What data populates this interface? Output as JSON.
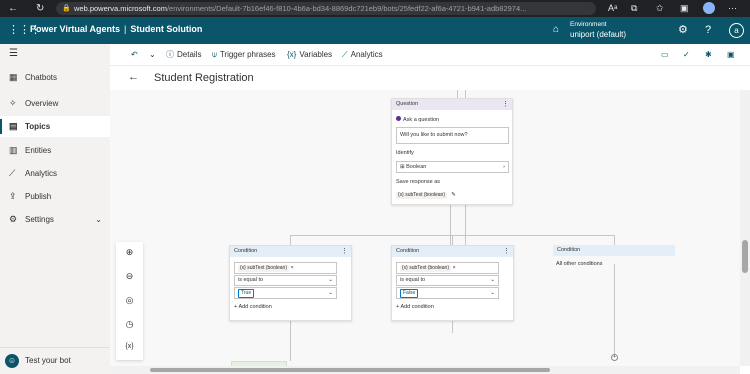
{
  "browser": {
    "url_domain": "web.powerva.microsoft.com",
    "url_path": "/environments/Default-7b16ef46-f810-4b6a-bd34-8869dc721eb9/bots/25fedf22-af6a-4721-b941-adb82974..."
  },
  "header": {
    "app_name": "Power Virtual Agents",
    "separator": "|",
    "bot_name": "Student Solution",
    "env_label": "Environment",
    "env_name": "uniport (default)",
    "avatar_initial": "a"
  },
  "sidebar": {
    "items": [
      {
        "label": "Chatbots"
      },
      {
        "label": "Overview"
      },
      {
        "label": "Topics"
      },
      {
        "label": "Entities"
      },
      {
        "label": "Analytics"
      },
      {
        "label": "Publish"
      },
      {
        "label": "Settings"
      }
    ],
    "test_bot": "Test your bot"
  },
  "toolbar": {
    "details": "Details",
    "trigger": "Trigger phrases",
    "variables": "Variables",
    "variables_icon": "{x}",
    "analytics": "Analytics"
  },
  "page": {
    "title": "Student Registration"
  },
  "question_node": {
    "header": "Question",
    "ask_label": "Ask a question",
    "question_text": "Will you like to submit now?",
    "identify_label": "Identify",
    "identify_value": "Boolean",
    "save_label": "Save response as",
    "variable": "subText (boolean)"
  },
  "conditions": [
    {
      "header": "Condition",
      "variable": "subText (boolean)",
      "operator": "is equal to",
      "value": "True",
      "add": "Add condition"
    },
    {
      "header": "Condition",
      "variable": "subText (boolean)",
      "operator": "is equal to",
      "value": "False",
      "add": "Add condition"
    },
    {
      "header": "Condition",
      "other": "All other conditions"
    }
  ],
  "canvas_tools": {
    "variables_icon": "{x}"
  }
}
